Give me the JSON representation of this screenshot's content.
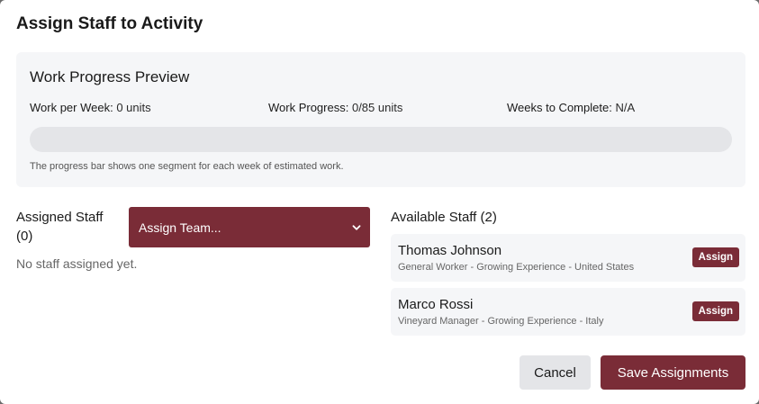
{
  "dialog": {
    "title": "Assign Staff to Activity"
  },
  "preview": {
    "title": "Work Progress Preview",
    "work_per_week_label": "Work per Week:",
    "work_per_week_value": "0 units",
    "work_progress_label": "Work Progress:",
    "work_progress_value": "0/85 units",
    "weeks_label": "Weeks to Complete:",
    "weeks_value": "N/A",
    "progress_fraction": 0,
    "note": "The progress bar shows one segment for each week of estimated work."
  },
  "assigned": {
    "heading": "Assigned Staff (0)",
    "team_select_value": "Assign Team...",
    "empty_text": "No staff assigned yet."
  },
  "available": {
    "heading": "Available Staff (2)",
    "staff": [
      {
        "name": "Thomas Johnson",
        "description": "General Worker - Growing Experience - United States",
        "button_label": "Assign"
      },
      {
        "name": "Marco Rossi",
        "description": "Vineyard Manager - Growing Experience - Italy",
        "button_label": "Assign"
      }
    ]
  },
  "footer": {
    "cancel_label": "Cancel",
    "save_label": "Save Assignments"
  },
  "colors": {
    "accent": "#7a2c37",
    "panel_bg": "#f5f6f8",
    "track": "#e4e5e8"
  }
}
